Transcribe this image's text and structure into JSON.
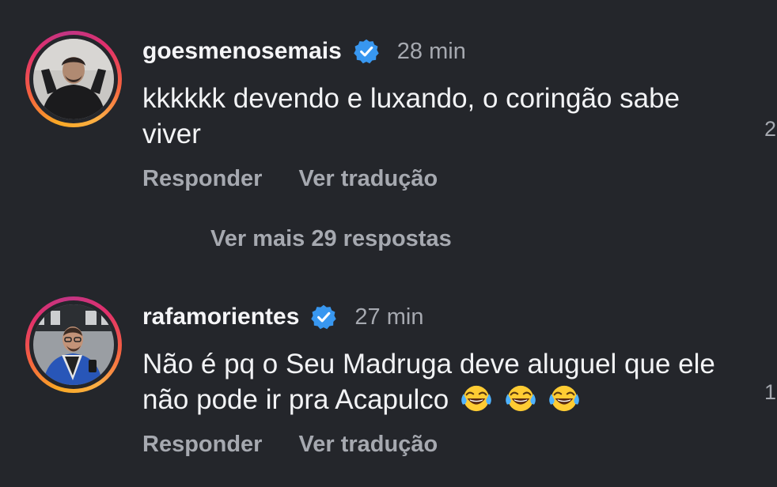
{
  "comments": [
    {
      "username": "goesmenosemais",
      "verified": true,
      "time": "28 min",
      "text": "kkkkkk devendo e luxando, o coringão sabe viver",
      "emojis": [],
      "actions": {
        "reply": "Responder",
        "translate": "Ver tradução"
      },
      "side_count": "2"
    },
    {
      "username": "rafamorientes",
      "verified": true,
      "time": "27 min",
      "text": "Não é pq o Seu Madruga deve aluguel que ele não pode ir pra Acapulco",
      "emojis": [
        "face-with-tears-of-joy",
        "face-with-tears-of-joy",
        "face-with-tears-of-joy"
      ],
      "actions": {
        "reply": "Responder",
        "translate": "Ver tradução"
      },
      "side_count": "1"
    }
  ],
  "more_replies": "Ver mais 29 respostas",
  "colors": {
    "background": "#24262b",
    "text_primary": "#f2f3f5",
    "text_secondary": "#a6a9b0",
    "verified_badge": "#3897f0"
  }
}
